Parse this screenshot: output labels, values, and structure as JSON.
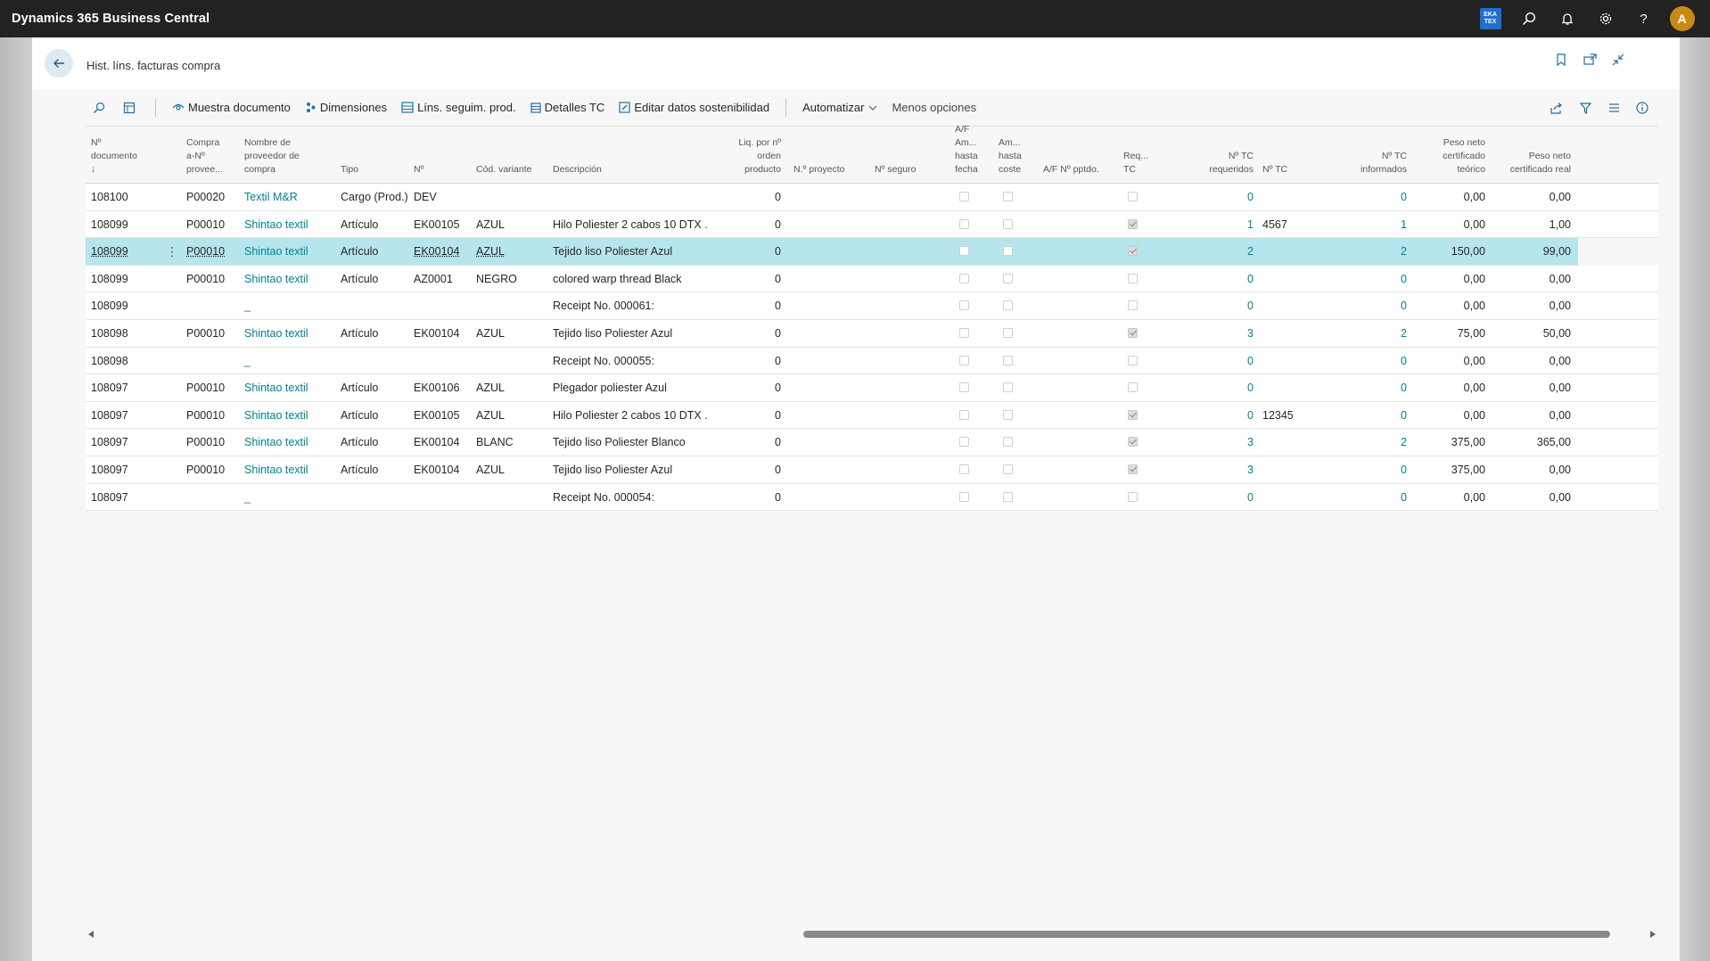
{
  "app": {
    "title": "Dynamics 365 Business Central",
    "company_badge": [
      "EKA",
      "TEX"
    ],
    "user_initial": "A"
  },
  "page": {
    "title": "Hist. líns. facturas compra"
  },
  "actions": {
    "show_document": "Muestra documento",
    "dimensions": "Dimensiones",
    "item_tracking": "Líns. seguim. prod.",
    "tc_details": "Detalles TC",
    "edit_sustainability": "Editar datos sostenibilidad",
    "automate": "Automatizar",
    "fewer_options": "Menos opciones"
  },
  "columns": {
    "doc_no": [
      "Nº",
      "documento",
      "↓"
    ],
    "buy_from": [
      "Compra",
      "a-Nº",
      "provee..."
    ],
    "vendor_name": [
      "Nombre de",
      "proveedor de",
      "compra"
    ],
    "type": [
      "Tipo"
    ],
    "no": [
      "Nº"
    ],
    "variant": [
      "Cód. variante"
    ],
    "description": [
      "Descripción"
    ],
    "liq": [
      "Liq. por nº",
      "orden",
      "producto"
    ],
    "project": [
      "N.º proyecto"
    ],
    "insurance": [
      "Nº seguro"
    ],
    "af_date": [
      "A/F",
      "Am...",
      "hasta",
      "fecha"
    ],
    "am_cost": [
      "Am...",
      "hasta",
      "coste"
    ],
    "af_pending": [
      "A/F Nº pptdo."
    ],
    "req_tc": [
      "Req...",
      "TC"
    ],
    "tc_required": [
      "Nº TC",
      "requeridos"
    ],
    "tc_no": [
      "Nº TC"
    ],
    "tc_informed": [
      "Nº TC",
      "informados"
    ],
    "net_theoretical": [
      "Peso neto",
      "certificado",
      "teórico"
    ],
    "net_real": [
      "Peso neto",
      "certificado real"
    ]
  },
  "rows": [
    {
      "doc": "108100",
      "vendor": "P00020",
      "name": "Textil M&R",
      "type": "Cargo (Prod.)",
      "no": "DEV",
      "variant": "",
      "desc": "",
      "liq": "0",
      "af": false,
      "am": false,
      "req": false,
      "tcreq": "0",
      "tcno": "",
      "tcinf": "0",
      "teo": "0,00",
      "real": "0,00"
    },
    {
      "doc": "108099",
      "vendor": "P00010",
      "name": "Shintao textil",
      "type": "Artículo",
      "no": "EK00105",
      "variant": "AZUL",
      "desc": "Hilo Poliester 2 cabos 10 DTX ...",
      "liq": "0",
      "af": false,
      "am": false,
      "req": true,
      "tcreq": "1",
      "tcno": "4567",
      "tcinf": "1",
      "teo": "0,00",
      "real": "1,00"
    },
    {
      "doc": "108099",
      "vendor": "P00010",
      "name": "Shintao textil",
      "type": "Artículo",
      "no": "EK00104",
      "variant": "AZUL",
      "desc": "Tejido liso Poliester Azul",
      "liq": "0",
      "af": false,
      "am": false,
      "req": true,
      "tcreq": "2",
      "tcno": "",
      "tcinf": "2",
      "teo": "150,00",
      "real": "99,00",
      "selected": true
    },
    {
      "doc": "108099",
      "vendor": "P00010",
      "name": "Shintao textil",
      "type": "Artículo",
      "no": "AZ0001",
      "variant": "NEGRO",
      "desc": "colored warp thread Black",
      "liq": "0",
      "af": false,
      "am": false,
      "req": false,
      "tcreq": "0",
      "tcno": "",
      "tcinf": "0",
      "teo": "0,00",
      "real": "0,00"
    },
    {
      "doc": "108099",
      "vendor": "",
      "name": "_",
      "type": "",
      "no": "",
      "variant": "",
      "desc": "Receipt No. 000061:",
      "liq": "0",
      "af": false,
      "am": false,
      "req": false,
      "tcreq": "0",
      "tcno": "",
      "tcinf": "0",
      "teo": "0,00",
      "real": "0,00"
    },
    {
      "doc": "108098",
      "vendor": "P00010",
      "name": "Shintao textil",
      "type": "Artículo",
      "no": "EK00104",
      "variant": "AZUL",
      "desc": "Tejido liso Poliester Azul",
      "liq": "0",
      "af": false,
      "am": false,
      "req": true,
      "tcreq": "3",
      "tcno": "",
      "tcinf": "2",
      "teo": "75,00",
      "real": "50,00"
    },
    {
      "doc": "108098",
      "vendor": "",
      "name": "_",
      "type": "",
      "no": "",
      "variant": "",
      "desc": "Receipt No. 000055:",
      "liq": "0",
      "af": false,
      "am": false,
      "req": false,
      "tcreq": "0",
      "tcno": "",
      "tcinf": "0",
      "teo": "0,00",
      "real": "0,00"
    },
    {
      "doc": "108097",
      "vendor": "P00010",
      "name": "Shintao textil",
      "type": "Artículo",
      "no": "EK00106",
      "variant": "AZUL",
      "desc": "Plegador poliester Azul",
      "liq": "0",
      "af": false,
      "am": false,
      "req": false,
      "tcreq": "0",
      "tcno": "",
      "tcinf": "0",
      "teo": "0,00",
      "real": "0,00"
    },
    {
      "doc": "108097",
      "vendor": "P00010",
      "name": "Shintao textil",
      "type": "Artículo",
      "no": "EK00105",
      "variant": "AZUL",
      "desc": "Hilo Poliester 2 cabos 10 DTX ...",
      "liq": "0",
      "af": false,
      "am": false,
      "req": true,
      "tcreq": "0",
      "tcno": "12345",
      "tcinf": "0",
      "teo": "0,00",
      "real": "0,00"
    },
    {
      "doc": "108097",
      "vendor": "P00010",
      "name": "Shintao textil",
      "type": "Artículo",
      "no": "EK00104",
      "variant": "BLANC",
      "desc": "Tejido liso Poliester Blanco",
      "liq": "0",
      "af": false,
      "am": false,
      "req": true,
      "tcreq": "3",
      "tcno": "",
      "tcinf": "2",
      "teo": "375,00",
      "real": "365,00"
    },
    {
      "doc": "108097",
      "vendor": "P00010",
      "name": "Shintao textil",
      "type": "Artículo",
      "no": "EK00104",
      "variant": "AZUL",
      "desc": "Tejido liso Poliester Azul",
      "liq": "0",
      "af": false,
      "am": false,
      "req": true,
      "tcreq": "3",
      "tcno": "",
      "tcinf": "0",
      "teo": "375,00",
      "real": "0,00"
    },
    {
      "doc": "108097",
      "vendor": "",
      "name": "_",
      "type": "",
      "no": "",
      "variant": "",
      "desc": "Receipt No. 000054:",
      "liq": "0",
      "af": false,
      "am": false,
      "req": false,
      "tcreq": "0",
      "tcno": "",
      "tcinf": "0",
      "teo": "0,00",
      "real": "0,00"
    }
  ],
  "colors": {
    "topbar": "#222222",
    "link": "#00828f",
    "selected_row": "#b7e5ee",
    "avatar": "#c98a14",
    "company_badge": "#1f6fd1"
  }
}
